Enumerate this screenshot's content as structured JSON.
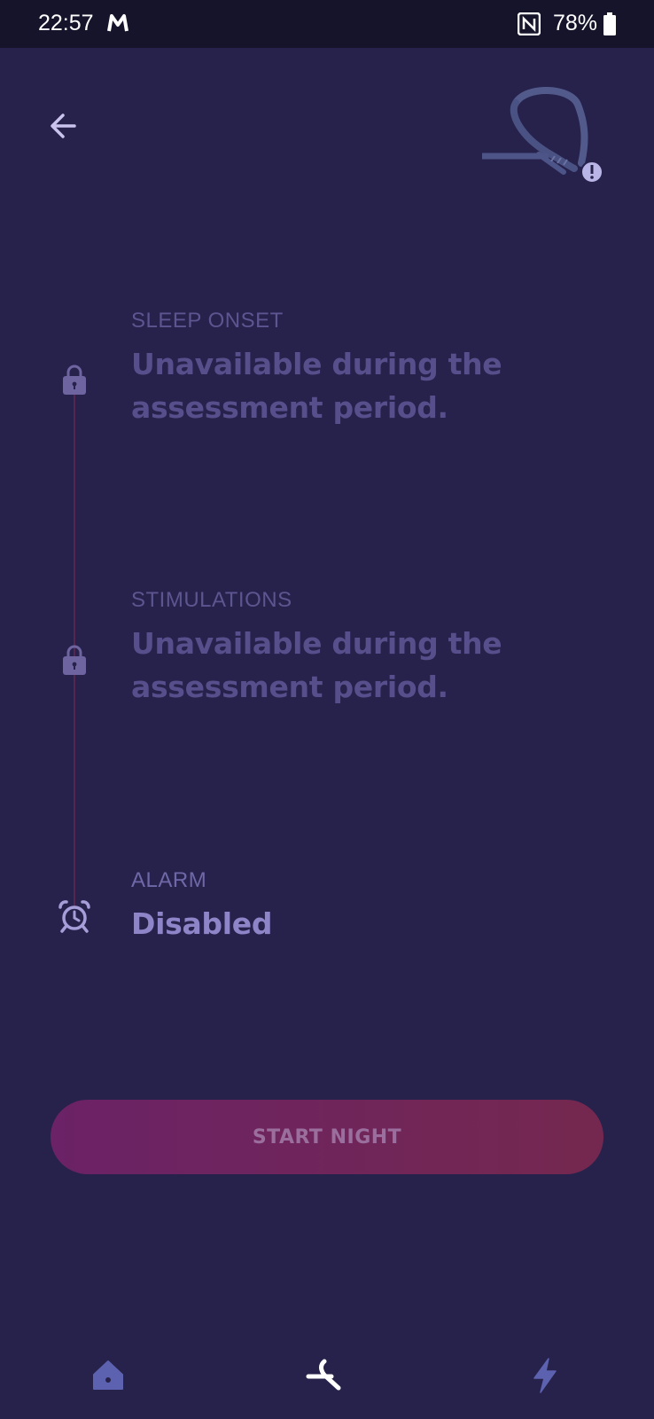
{
  "status_bar": {
    "time": "22:57",
    "battery_percent": "78%",
    "icons": [
      "mail-m-icon",
      "nfc-icon",
      "battery-icon"
    ]
  },
  "header": {
    "back_icon": "arrow-left-icon",
    "device_icon": "headband-device-warning-icon"
  },
  "sections": {
    "sleep_onset": {
      "label": "SLEEP ONSET",
      "value_line1": "Unavailable during the",
      "value_line2": "assessment period.",
      "icon": "lock-icon"
    },
    "stimulations": {
      "label": "STIMULATIONS",
      "value_line1": "Unavailable during the",
      "value_line2": "assessment period.",
      "icon": "lock-icon"
    },
    "alarm": {
      "label": "ALARM",
      "value": "Disabled",
      "icon": "alarm-clock-icon"
    }
  },
  "start_button": {
    "label": "START NIGHT"
  },
  "bottom_nav": {
    "items": [
      {
        "name": "home",
        "icon": "home-icon"
      },
      {
        "name": "device",
        "icon": "headband-icon",
        "active": true
      },
      {
        "name": "energy",
        "icon": "lightning-icon"
      }
    ]
  },
  "colors": {
    "background": "#27224b",
    "status_bar": "#16142b",
    "muted_text": "#574f8c",
    "button_gradient_start": "#6b2266",
    "button_gradient_end": "#74284f"
  }
}
